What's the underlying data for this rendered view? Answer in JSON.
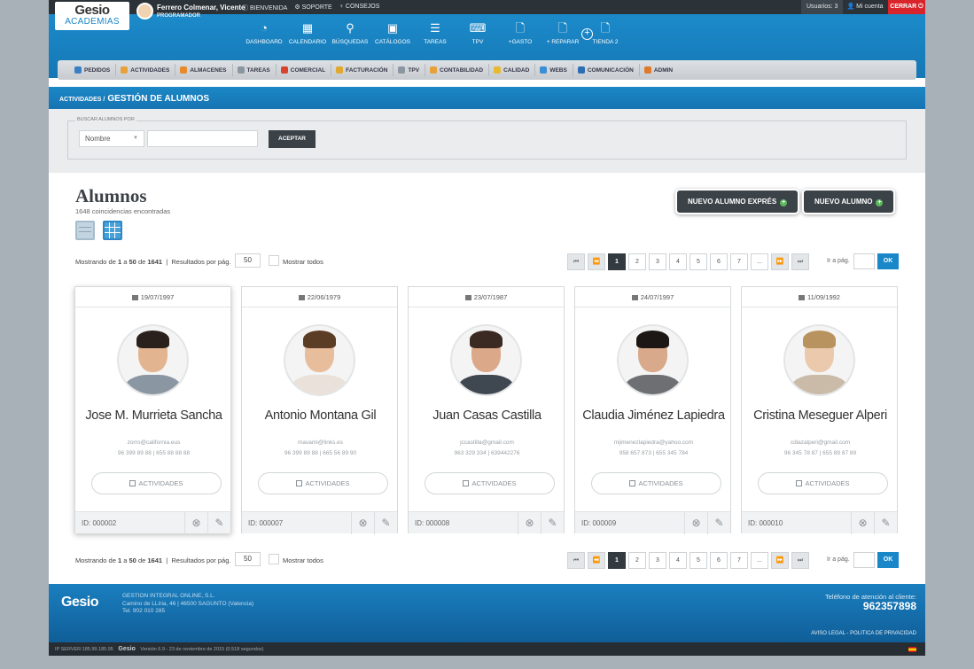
{
  "topbar": {
    "logo_main": "Gesio",
    "logo_sub": "ACADEMIAS",
    "user_name": "Ferrero Colmenar, Vicente",
    "user_role": "PROGRAMADOR",
    "links": [
      "BIENVENIDA",
      "SOPORTE",
      "CONSEJOS"
    ],
    "users_count": "Usuarios: 3",
    "my_account": "Mi cuenta",
    "close": "CERRAR"
  },
  "main_nav": [
    {
      "label": "DASHBOARD",
      "icon": "gauge-icon",
      "glyph": "◔"
    },
    {
      "label": "CALENDARIO",
      "icon": "calendar-icon",
      "glyph": "▦"
    },
    {
      "label": "BÚSQUEDAS",
      "icon": "search-icon",
      "glyph": "⚲"
    },
    {
      "label": "CATÁLOGOS",
      "icon": "catalog-icon",
      "glyph": "▣"
    },
    {
      "label": "TAREAS",
      "icon": "list-icon",
      "glyph": "☰"
    },
    {
      "label": "TPV",
      "icon": "register-icon",
      "glyph": "⌨"
    },
    {
      "label": "+GASTO",
      "icon": "document-icon",
      "glyph": "🗋"
    },
    {
      "label": "+ REPARAR",
      "icon": "document-icon",
      "glyph": "🗋"
    },
    {
      "label": "TIENDA 2",
      "icon": "document-icon",
      "glyph": "🗋"
    }
  ],
  "sub_nav": [
    {
      "label": "PEDIDOS",
      "color": "#3a7fc4"
    },
    {
      "label": "ACTIVIDADES",
      "color": "#e8a13a"
    },
    {
      "label": "ALMACENES",
      "color": "#e88a2a"
    },
    {
      "label": "TAREAS",
      "color": "#8a96a0"
    },
    {
      "label": "COMERCIAL",
      "color": "#d9432b"
    },
    {
      "label": "FACTURACIÓN",
      "color": "#e0a92e"
    },
    {
      "label": "TPV",
      "color": "#8a96a0"
    },
    {
      "label": "CONTABILIDAD",
      "color": "#e8a13a"
    },
    {
      "label": "CALIDAD",
      "color": "#e8b82e"
    },
    {
      "label": "WEBS",
      "color": "#3a8fd4"
    },
    {
      "label": "COMUNICACIÓN",
      "color": "#2d6db4"
    },
    {
      "label": "ADMIN",
      "color": "#e07a2a"
    }
  ],
  "breadcrumb": {
    "parent": "ACTIVIDADES /",
    "current": "GESTIÓN DE ALUMNOS"
  },
  "search": {
    "legend": "BUSCAR ALUMNOS POR",
    "field": "Nombre",
    "value": "",
    "button": "ACEPTAR"
  },
  "content": {
    "title": "Alumnos",
    "subtitle": "1648 coincidencias encontradas",
    "btn_express": "NUEVO ALUMNO EXPRÉS",
    "btn_new": "NUEVO ALUMNO"
  },
  "pagination": {
    "showing_prefix": "Mostrando de",
    "from": "1",
    "sep_a": "a",
    "to": "50",
    "sep_de": "de",
    "total": "1641",
    "per_page_label": "Resultados por pág.",
    "per_page": "50",
    "show_all": "Mostrar todos",
    "pages": [
      "1",
      "2",
      "3",
      "4",
      "5",
      "6",
      "7",
      "..."
    ],
    "goto_label": "Ir a pág.",
    "ok": "OK"
  },
  "students": [
    {
      "date": "19/07/1997",
      "name": "Jose M. Murrieta Sancha",
      "email": "zorro@california.eus",
      "phone": "96 399 89 88 | 655 88 88 88",
      "id": "ID: 000002",
      "skin": "#e2b48f",
      "hair": "#2a211c",
      "shirt": "#8a96a2"
    },
    {
      "date": "22/06/1979",
      "name": "Antonio Montana Gil",
      "email": "mavami@links.es",
      "phone": "96 399 89 88 | 665 56 89 90",
      "id": "ID: 000007",
      "skin": "#e7bd9c",
      "hair": "#5b3c25",
      "shirt": "#e9e1da"
    },
    {
      "date": "23/07/1987",
      "name": "Juan Casas Castilla",
      "email": "jccastilla@gmail.com",
      "phone": "963 329 334 | 639442276",
      "id": "ID: 000008",
      "skin": "#dca88a",
      "hair": "#3b2a22",
      "shirt": "#3f4750"
    },
    {
      "date": "24/07/1997",
      "name": "Claudia Jiménez Lapiedra",
      "email": "mjimenezlapiedra@yahoo.com",
      "phone": "958 657 873 | 655 345 784",
      "id": "ID: 000009",
      "skin": "#d8a98a",
      "hair": "#1c1614",
      "shirt": "#6d6f73"
    },
    {
      "date": "11/09/1992",
      "name": "Cristina Meseguer Alperi",
      "email": "cdiazalperi@gmail.com",
      "phone": "96 345 78 87 | 655 89 87 89",
      "id": "ID: 000010",
      "skin": "#ebc9ad",
      "hair": "#b9935f",
      "shirt": "#c9bba8"
    }
  ],
  "card_labels": {
    "activities": "ACTIVIDADES"
  },
  "footer": {
    "logo": "Gesio",
    "company": [
      "GESTION INTEGRAL ONLINE, S.L.",
      "Camino de LLíria, 46 | 46500 SAGUNTO (Valencia)",
      "Tel. 902 010 285"
    ],
    "phone_label": "Teléfono de atención al cliente:",
    "phone": "962357898",
    "legal": "AVISO LEGAL - POLITICA DE PRIVACIDAD",
    "ip": "IP SERVER:185.99.185.95",
    "version": "Versión 6.9 - 23 de noviembre de 2015 (0.518 segundos)"
  }
}
